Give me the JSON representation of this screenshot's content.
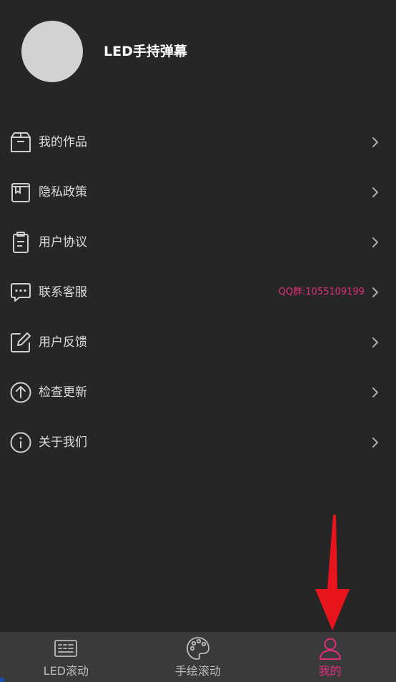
{
  "header": {
    "app_name": "LED手持弹幕"
  },
  "menu": {
    "items": [
      {
        "label": "我的作品",
        "icon": "box-icon",
        "extra": ""
      },
      {
        "label": "隐私政策",
        "icon": "book-icon",
        "extra": ""
      },
      {
        "label": "用户协议",
        "icon": "clipboard-icon",
        "extra": ""
      },
      {
        "label": "联系客服",
        "icon": "chat-bubble-icon",
        "extra": "QQ群:1055109199"
      },
      {
        "label": "用户反馈",
        "icon": "edit-icon",
        "extra": ""
      },
      {
        "label": "检查更新",
        "icon": "upload-circle-icon",
        "extra": ""
      },
      {
        "label": "关于我们",
        "icon": "info-icon",
        "extra": ""
      }
    ]
  },
  "tabbar": {
    "tabs": [
      {
        "label": "LED滚动",
        "icon": "keyboard-icon",
        "active": false
      },
      {
        "label": "手绘滚动",
        "icon": "palette-icon",
        "active": false
      },
      {
        "label": "我的",
        "icon": "user-icon",
        "active": true
      }
    ]
  },
  "colors": {
    "background": "#262626",
    "tabbar_background": "#3a3a3a",
    "accent": "#e0307a",
    "annotation_arrow": "#e8141c",
    "avatar": "#d2d2d2"
  }
}
